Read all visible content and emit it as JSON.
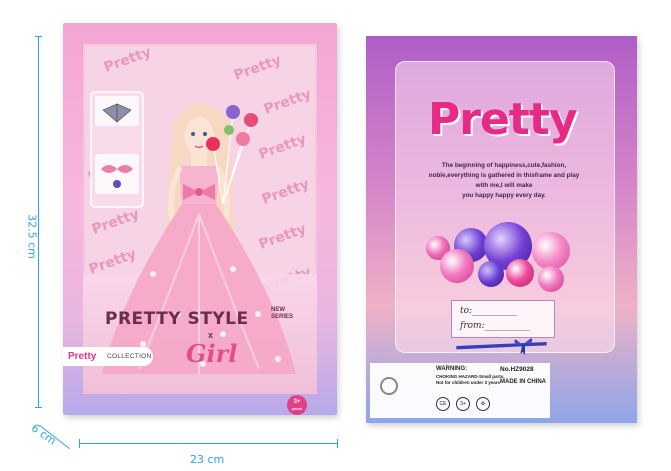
{
  "dimensions": {
    "height": "32.5 cm",
    "width": "23 cm",
    "depth": "6 cm"
  },
  "front": {
    "pattern_word": "Pretty",
    "title": "PRETTY STYLE",
    "new_series": "NEW SERIES",
    "x": "x",
    "girl": "Girl",
    "brand": "Pretty",
    "collection": "COLLECTION",
    "age": "3+",
    "age_sub": "years"
  },
  "back": {
    "title": "Pretty",
    "desc": [
      "The beginning of happiness,cute,fashion,",
      "noble,everything is gathered in thisframe and play",
      "with me,I will make",
      "you happy happy every day."
    ],
    "to": "to:__________",
    "from": "from:__________",
    "warning": "WARNING:",
    "warning_sub": "CHOKING HAZARD-Small parts.",
    "warning_sub2": "Not for children under 3 years",
    "model": "No.HZ9028",
    "made_in": "MADE IN CHINA",
    "certs": [
      "CE",
      "3+",
      "♻"
    ]
  },
  "colors": {
    "dimension": "#2aa6de",
    "brand_pink": "#e62a85",
    "front_box": "#f4a6d2",
    "back_box": "#b05dc7"
  }
}
